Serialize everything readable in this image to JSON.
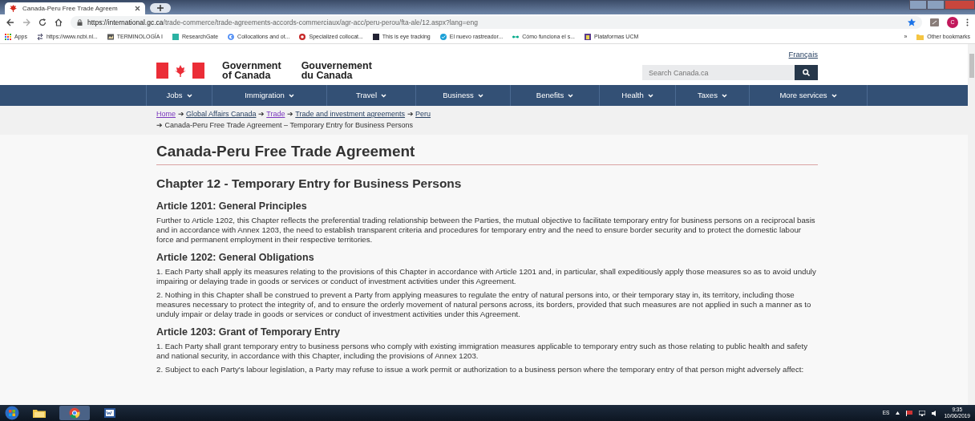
{
  "browser": {
    "tab_title": "Canada-Peru Free Trade Agreem",
    "url_host": "https://international.gc.ca",
    "url_path": "/trade-commerce/trade-agreements-accords-commerciaux/agr-acc/peru-perou/fta-ale/12.aspx?lang=eng",
    "profile_initial": "C",
    "bookmarks": [
      {
        "label": "Apps"
      },
      {
        "label": "https://www.ncbi.nl..."
      },
      {
        "label": "TERMINOLOGÍA I"
      },
      {
        "label": "ResearchGate"
      },
      {
        "label": "Collocations and ot..."
      },
      {
        "label": "Specialized collocat..."
      },
      {
        "label": "This is eye tracking"
      },
      {
        "label": "El nuevo rastreador..."
      },
      {
        "label": "Cómo funciona el s..."
      },
      {
        "label": "Plataformas UCM"
      }
    ],
    "more_bookmarks": "»",
    "other_bookmarks": "Other bookmarks"
  },
  "header": {
    "language_link": "Français",
    "gov_en": [
      "Government",
      "of Canada"
    ],
    "gov_fr": [
      "Gouvernement",
      "du Canada"
    ],
    "search_placeholder": "Search Canada.ca"
  },
  "menu": [
    {
      "label": "Jobs"
    },
    {
      "label": "Immigration"
    },
    {
      "label": "Travel"
    },
    {
      "label": "Business"
    },
    {
      "label": "Benefits"
    },
    {
      "label": "Health"
    },
    {
      "label": "Taxes"
    },
    {
      "label": "More services"
    }
  ],
  "breadcrumb": {
    "separator": "➔",
    "links": [
      "Home",
      "Global Affairs Canada",
      "Trade",
      "Trade and investment agreements",
      "Peru"
    ],
    "visited": [
      true,
      false,
      true,
      false,
      false
    ],
    "current": "Canada-Peru Free Trade Agreement – Temporary Entry for Business Persons"
  },
  "page_title": "Canada-Peru Free Trade Agreement",
  "chapter_title": "Chapter 12 - Temporary Entry for Business Persons",
  "articles": [
    {
      "title": "Article 1201: General Principles",
      "paragraphs": [
        "Further to Article 1202, this Chapter reflects the preferential trading relationship between the Parties, the mutual objective to facilitate temporary entry for business persons on a reciprocal basis and in accordance with Annex 1203, the need to establish transparent criteria and procedures for temporary entry and the need to ensure border security and to protect the domestic labour force and permanent employment in their respective territories."
      ]
    },
    {
      "title": "Article 1202: General Obligations",
      "paragraphs": [
        "1. Each Party shall apply its measures relating to the provisions of this Chapter in accordance with Article 1201 and, in particular, shall expeditiously apply those measures so as to avoid unduly impairing or delaying trade in goods or services or conduct of investment activities under this Agreement.",
        "2. Nothing in this Chapter shall be construed to prevent a Party from applying measures to regulate the entry of natural persons into, or their temporary stay in, its territory, including those measures necessary to protect the integrity of, and to ensure the orderly movement of natural persons across, its borders, provided that such measures are not applied in such a manner as to unduly impair or delay trade in goods or services or conduct of investment activities under this Agreement."
      ]
    },
    {
      "title": "Article 1203: Grant of Temporary Entry",
      "paragraphs": [
        "1. Each Party shall grant temporary entry to business persons who comply with existing immigration measures applicable to temporary entry such as those relating to public health and safety and national security, in accordance with this Chapter, including the provisions of Annex 1203.",
        "2. Subject to each Party's labour legislation, a Party may refuse to issue a work permit or authorization to a business person where the temporary entry of that person might adversely affect:"
      ]
    }
  ],
  "taskbar": {
    "apps": [
      {
        "kind": "explorer",
        "selected": false
      },
      {
        "kind": "chrome",
        "selected": true
      },
      {
        "kind": "word",
        "selected": false
      }
    ],
    "language": "ES",
    "time": "9:35",
    "date": "10/06/2019"
  }
}
